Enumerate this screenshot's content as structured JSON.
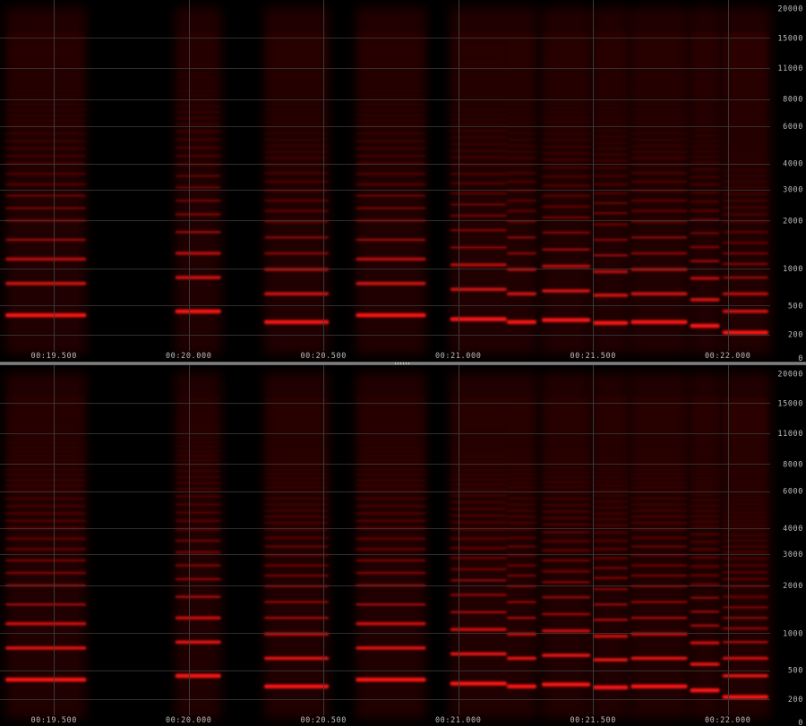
{
  "view": {
    "type": "spectrogram",
    "channels": [
      "channel-1",
      "channel-2"
    ],
    "colors": {
      "background": "#000000",
      "energy": "#ff1010",
      "grid": "#3a3a3a",
      "label": "#bdbdbd",
      "splitter": "#6e6e6e"
    },
    "time_ticks": [
      {
        "t": 19.5,
        "label": "00:19.500"
      },
      {
        "t": 20.0,
        "label": "00:20.000"
      },
      {
        "t": 20.5,
        "label": "00:20.500"
      },
      {
        "t": 21.0,
        "label": "00:21.000"
      },
      {
        "t": 21.5,
        "label": "00:21.500"
      },
      {
        "t": 22.0,
        "label": "00:22.000"
      }
    ],
    "freq_ticks": [
      {
        "hz": 20000,
        "label": "20000"
      },
      {
        "hz": 15000,
        "label": "15000"
      },
      {
        "hz": 11000,
        "label": "11000"
      },
      {
        "hz": 8000,
        "label": "8000"
      },
      {
        "hz": 6000,
        "label": "6000"
      },
      {
        "hz": 4000,
        "label": "4000"
      },
      {
        "hz": 3000,
        "label": "3000"
      },
      {
        "hz": 2000,
        "label": "2000"
      },
      {
        "hz": 1000,
        "label": "1000"
      },
      {
        "hz": 500,
        "label": "500"
      },
      {
        "hz": 200,
        "label": "200"
      },
      {
        "hz": 0,
        "label": "0"
      }
    ],
    "notes": [
      {
        "start": 19.32,
        "end": 19.62,
        "f0": 400
      },
      {
        "start": 19.95,
        "end": 20.12,
        "f0": 440
      },
      {
        "start": 20.28,
        "end": 20.52,
        "f0": 330
      },
      {
        "start": 20.62,
        "end": 20.88,
        "f0": 400
      },
      {
        "start": 20.97,
        "end": 21.18,
        "f0": 360
      },
      {
        "start": 21.18,
        "end": 21.29,
        "f0": 330
      },
      {
        "start": 21.31,
        "end": 21.49,
        "f0": 350
      },
      {
        "start": 21.5,
        "end": 21.63,
        "f0": 320
      },
      {
        "start": 21.64,
        "end": 21.85,
        "f0": 330
      },
      {
        "start": 21.86,
        "end": 21.97,
        "f0": 290
      },
      {
        "start": 21.98,
        "end": 22.16,
        "f0": 220
      }
    ]
  }
}
